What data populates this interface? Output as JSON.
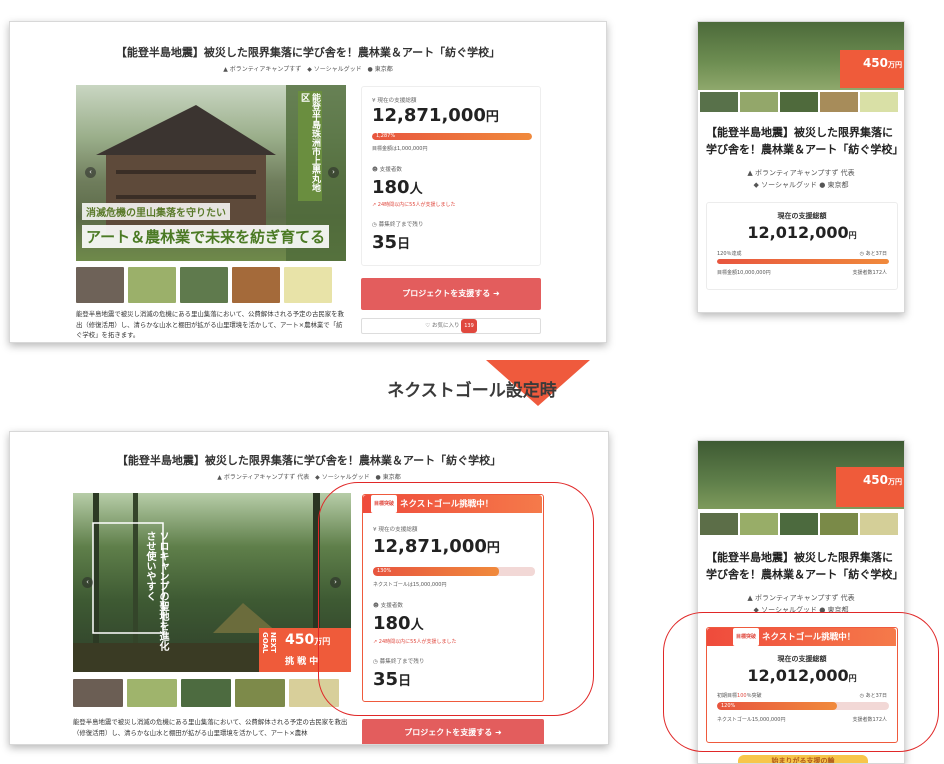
{
  "project": {
    "title": "【能登半島地震】被災した限界集落に学び舎を！農林業＆アート「紡ぐ学校」",
    "organizer": "ボランティアキャンプすず",
    "organizer_role": "代表",
    "category": "ソーシャルグッド",
    "location": "東京都",
    "description": "能登半島地震で被災し消滅の危機にある里山集落において、公費解体される予定の古民家を救出（修復活用）し、清らかな山水と棚田が拡がる山里環境を活かして、アート×農林業で「紡ぐ学校」を拓きます。",
    "description_cut": "能登半島地震で被災し消滅の危機にある里山集落において、公費解体される予定の古民家を救出（修復活用）し、清らかな山水と棚田が拡がる山里環境を活かして、アート×農林"
  },
  "hero_top": {
    "vertical_text": "能登半島珠洲市上黒丸地区",
    "caption1": "消滅危機の里山集落を守りたい",
    "caption2": "アート＆農林業で未来を紡ぎ育てる"
  },
  "hero_bottom": {
    "vertical_text": "ソロキャンプの聖地を進化させ使いやすく",
    "next_badge_word": "NEXT GOAL",
    "next_amount": "450",
    "next_unit": "万円",
    "next_status": "挑 戦 中"
  },
  "pc_before": {
    "raised_label": "現在の支援総額",
    "raised_amount": "12,871,000",
    "raised_unit": "円",
    "percent": "1,287%",
    "percent_value": 12.87,
    "goal_text": "目標金額は1,000,000円",
    "backers_label": "支援者数",
    "backers": "180",
    "backers_unit": "人",
    "recent_text": "24時間以内に55人が支援しました",
    "remaining_label": "募集終了まで残り",
    "remaining": "35",
    "remaining_unit": "日",
    "cta_label": "プロジェクトを支援する",
    "fav_label": "お気に入り",
    "fav_count": "139"
  },
  "pc_after": {
    "challenge_tag": "目標突破",
    "challenge_label": "ネクストゴール挑戦中！",
    "raised_label": "現在の支援総額",
    "raised_amount": "12,871,000",
    "raised_unit": "円",
    "percent": "130%",
    "percent_value": 1.3,
    "goal_text": "ネクストゴールは15,000,000円",
    "backers_label": "支援者数",
    "backers": "180",
    "backers_unit": "人",
    "recent_text": "24時間以内に55人が支援しました",
    "remaining_label": "募集終了まで残り",
    "remaining": "35",
    "remaining_unit": "日",
    "cta_label": "プロジェクトを支援する"
  },
  "mobile_before": {
    "title": "【能登半島地震】被災した限界集落に学び舎を！農林業＆アート「紡ぐ学校」",
    "raised_label": "現在の支援総額",
    "raised_amount": "12,012,000",
    "raised_unit": "円",
    "percent_text": "120％達成",
    "percent_value": 1.2,
    "remaining_text": "あと37日",
    "goal_text": "目標金額10,000,000円",
    "backers_text": "支援者数172人"
  },
  "mobile_after": {
    "challenge_tag": "目標突破",
    "challenge_label": "ネクストゴール挑戦中！",
    "raised_label": "現在の支援総額",
    "raised_amount": "12,012,000",
    "raised_unit": "円",
    "initial_goal_pre": "初期目標",
    "initial_goal_pct": "100",
    "initial_goal_post": "％突破",
    "percent": "120%",
    "percent_value": 0.8,
    "remaining_text": "あと37日",
    "goal_text": "ネクストゴール15,000,000円",
    "backers_text": "支援者数172人",
    "bottom_peek": "始まりがる支援の輪"
  },
  "divider": {
    "label": "ネクストゴール設定時"
  },
  "colors": {
    "accent": "#e8553e",
    "cta": "#e35d5d",
    "ring": "#e02828",
    "progress_track": "#f2d8d6"
  }
}
